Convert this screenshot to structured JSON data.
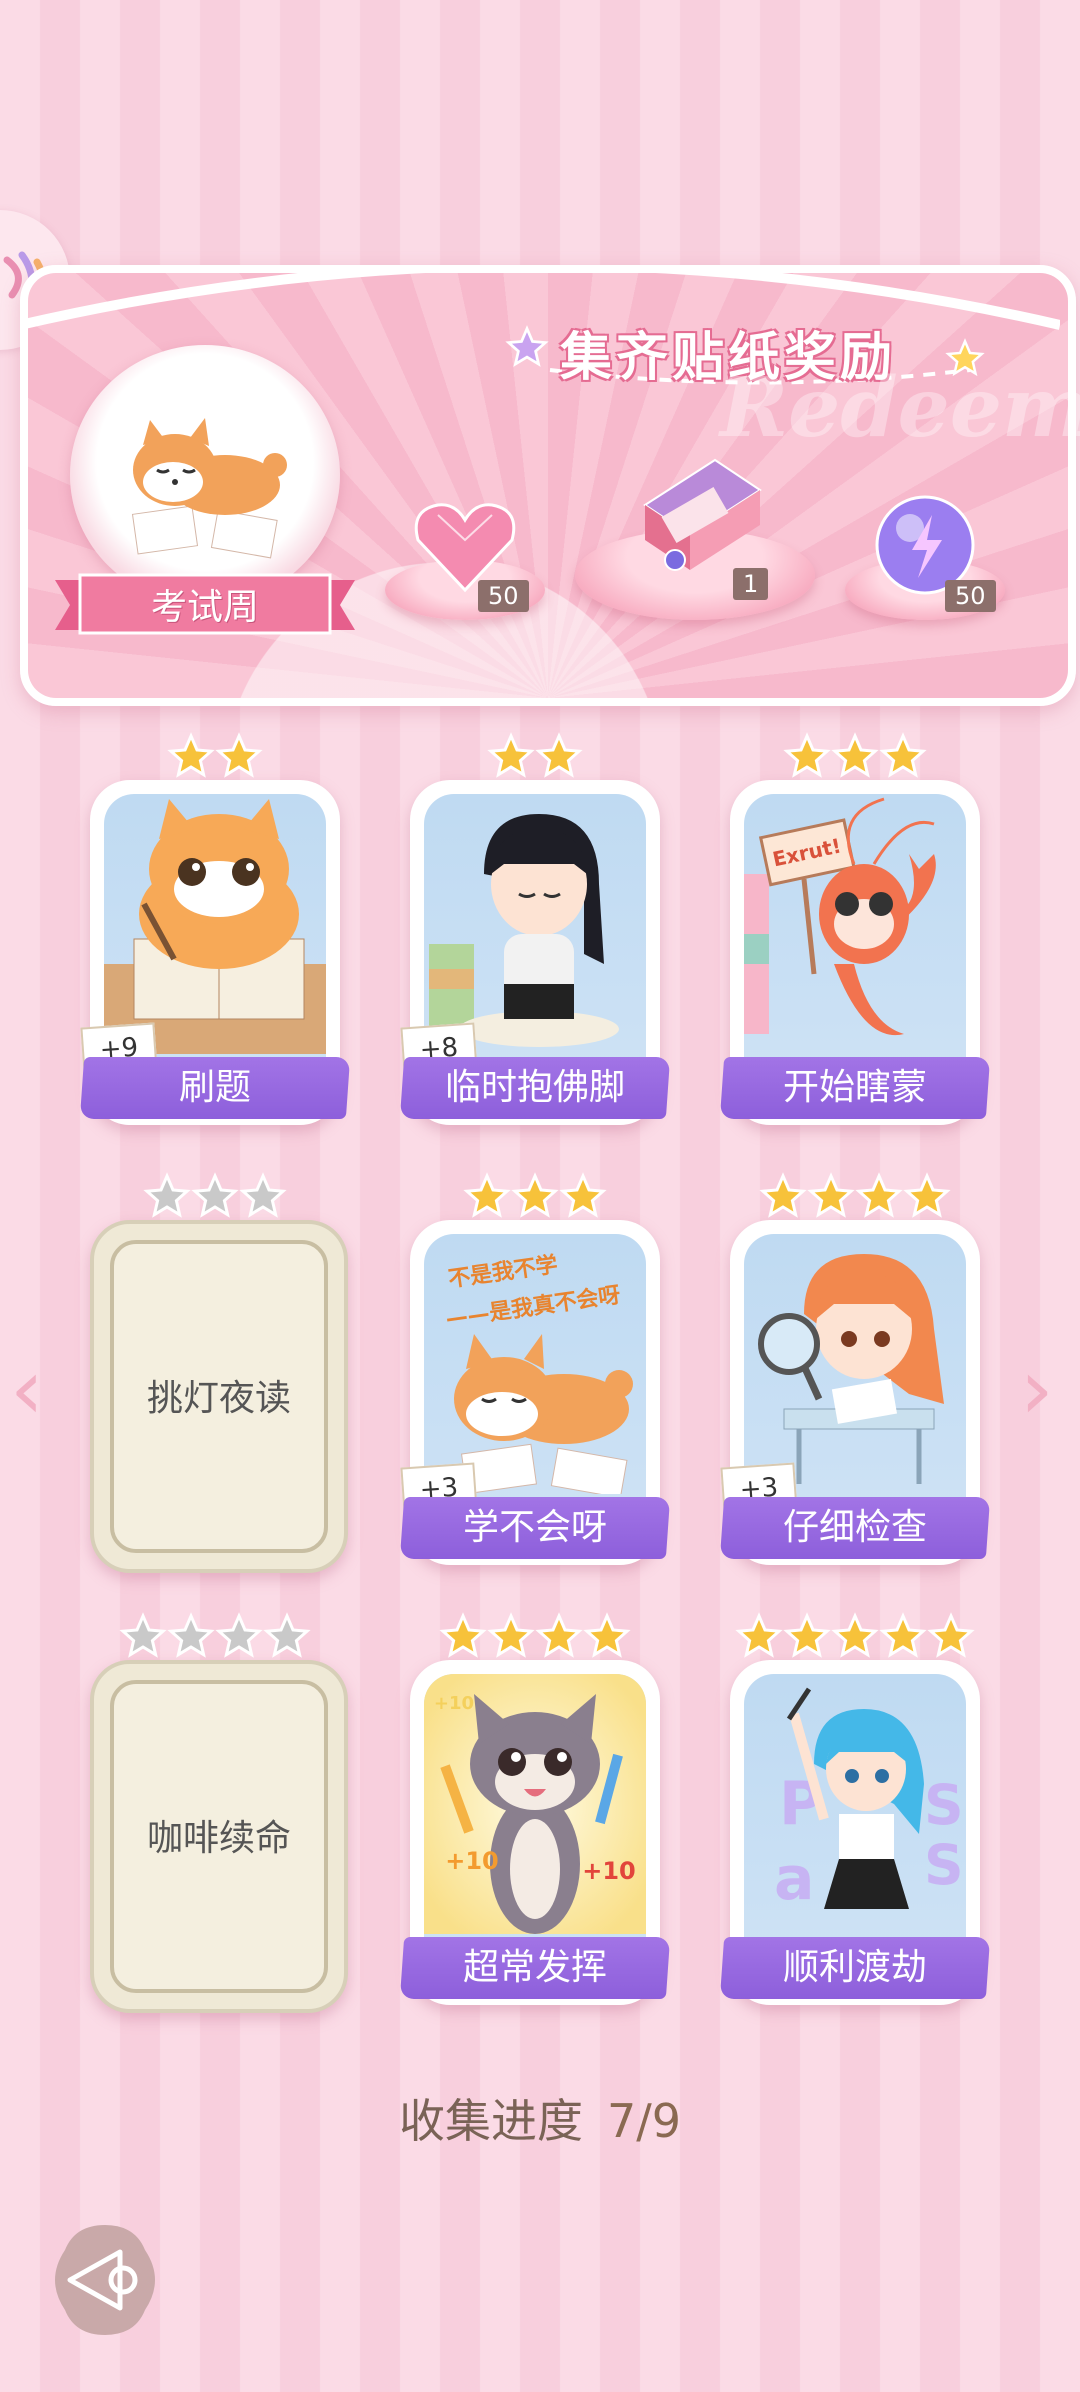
{
  "reward_panel": {
    "title": "集齐贴纸奖励",
    "watermark": "Redeem",
    "theme_label": "考试周",
    "rewards": [
      {
        "icon": "heart-gem-icon",
        "count": "50"
      },
      {
        "icon": "gift-box-icon",
        "count": "1"
      },
      {
        "icon": "energy-orb-icon",
        "count": "50"
      }
    ]
  },
  "cards": [
    {
      "name": "刷题",
      "stars": 2,
      "bonus": "+9",
      "owned": true
    },
    {
      "name": "临时抱佛脚",
      "stars": 2,
      "bonus": "+8",
      "owned": true
    },
    {
      "name": "开始瞎蒙",
      "stars": 3,
      "bonus": "",
      "owned": true,
      "sign_text": "Exrut!"
    },
    {
      "name": "挑灯夜读",
      "stars": 3,
      "bonus": "",
      "owned": false
    },
    {
      "name": "学不会呀",
      "stars": 3,
      "bonus": "+3",
      "owned": true,
      "art_text_1": "不是我不学",
      "art_text_2": "——是我真不会呀"
    },
    {
      "name": "仔细检查",
      "stars": 4,
      "bonus": "+3",
      "owned": true
    },
    {
      "name": "咖啡续命",
      "stars": 4,
      "bonus": "",
      "owned": false
    },
    {
      "name": "超常发挥",
      "stars": 4,
      "bonus": "",
      "owned": true,
      "art_text_1": "+10",
      "art_text_2": "+10",
      "art_text_3": "+10"
    },
    {
      "name": "顺利渡劫",
      "stars": 5,
      "bonus": "",
      "owned": true
    }
  ],
  "progress": {
    "label": "收集进度",
    "value": "7/9"
  },
  "colors": {
    "accent": "#8d5fdb",
    "star_gold": "#f7c23a",
    "star_gray": "#c9c9c9"
  }
}
